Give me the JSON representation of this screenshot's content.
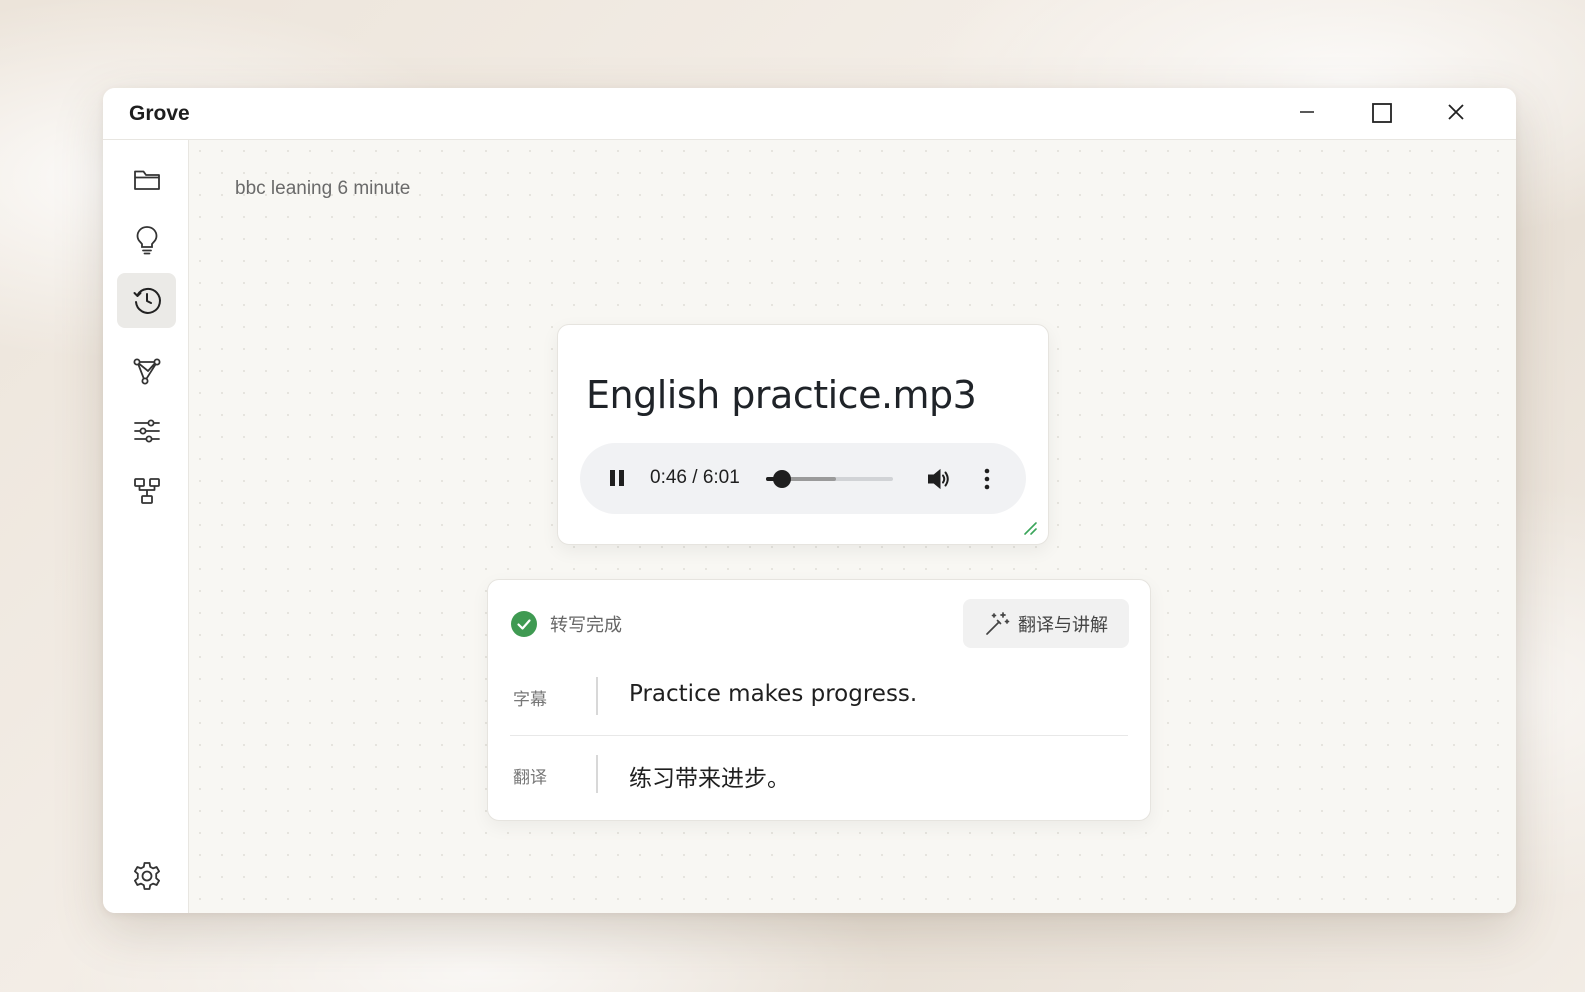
{
  "window": {
    "title": "Grove",
    "controls": {
      "minimize": "minimize-icon",
      "maximize": "maximize-icon",
      "close": "close-icon"
    }
  },
  "sidebar": {
    "items": [
      {
        "id": "files",
        "icon": "folder-icon",
        "active": false
      },
      {
        "id": "ideas",
        "icon": "lightbulb-icon",
        "active": false
      },
      {
        "id": "history",
        "icon": "history-icon",
        "active": true
      },
      {
        "id": "graph",
        "icon": "graph-nodes-icon",
        "active": false
      },
      {
        "id": "adjust",
        "icon": "sliders-icon",
        "active": false
      },
      {
        "id": "workflow",
        "icon": "flowchart-icon",
        "active": false
      }
    ],
    "settings_icon": "gear-icon"
  },
  "main": {
    "breadcrumb": "bbc leaning 6 minute",
    "player_card": {
      "file_title": "English practice.mp3",
      "time_display": "0:46 / 6:01",
      "current_seconds": 46,
      "duration_seconds": 361,
      "buffered_fraction": 0.55,
      "icons": {
        "pause": "pause-icon",
        "volume": "volume-icon",
        "more": "more-vertical-icon",
        "resize": "resize-grip-icon"
      }
    },
    "transcript_card": {
      "status_text": "转写完成",
      "status_icon": "check-circle-icon",
      "translate_button": "翻译与讲解",
      "translate_icon": "magic-wand-icon",
      "rows": [
        {
          "label": "字幕",
          "text": "Practice makes progress."
        },
        {
          "label": "翻译",
          "text": "练习带来进步。"
        }
      ]
    }
  },
  "colors": {
    "accent_green": "#3f9a52",
    "resize_grip": "#3aa55a",
    "active_nav_bg": "#ebeae7"
  }
}
